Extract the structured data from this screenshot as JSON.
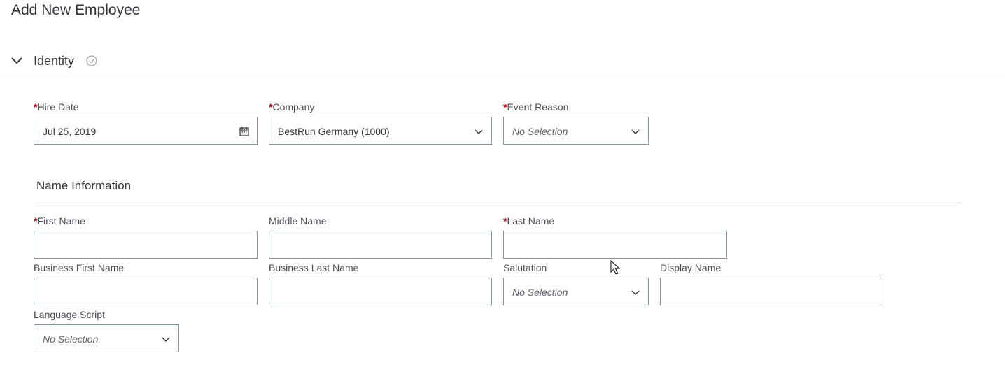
{
  "page_title": "Add New Employee",
  "section": {
    "title": "Identity",
    "status_icon": "check-circle-icon",
    "chevron_icon": "chevron-down-icon"
  },
  "identity": {
    "hire_date": {
      "label": "Hire Date",
      "value": "Jul 25, 2019",
      "icon": "calendar-icon"
    },
    "company": {
      "label": "Company",
      "value": "BestRun Germany (1000)",
      "icon": "chevron-down-icon"
    },
    "event_reason": {
      "label": "Event Reason",
      "value": "No Selection",
      "icon": "chevron-down-icon"
    }
  },
  "name_information": {
    "title": "Name Information",
    "first_name": {
      "label": "First Name",
      "value": ""
    },
    "middle_name": {
      "label": "Middle Name",
      "value": ""
    },
    "last_name": {
      "label": "Last Name",
      "value": ""
    },
    "business_first_name": {
      "label": "Business First Name",
      "value": ""
    },
    "business_last_name": {
      "label": "Business Last Name",
      "value": ""
    },
    "salutation": {
      "label": "Salutation",
      "value": "No Selection"
    },
    "display_name": {
      "label": "Display Name",
      "value": ""
    },
    "language_script": {
      "label": "Language Script",
      "value": "No Selection"
    }
  },
  "required_marker": "*",
  "colors": {
    "required": "#bb0000",
    "border": "#89919a",
    "text": "#32363a",
    "divider": "#d9d9d9"
  }
}
